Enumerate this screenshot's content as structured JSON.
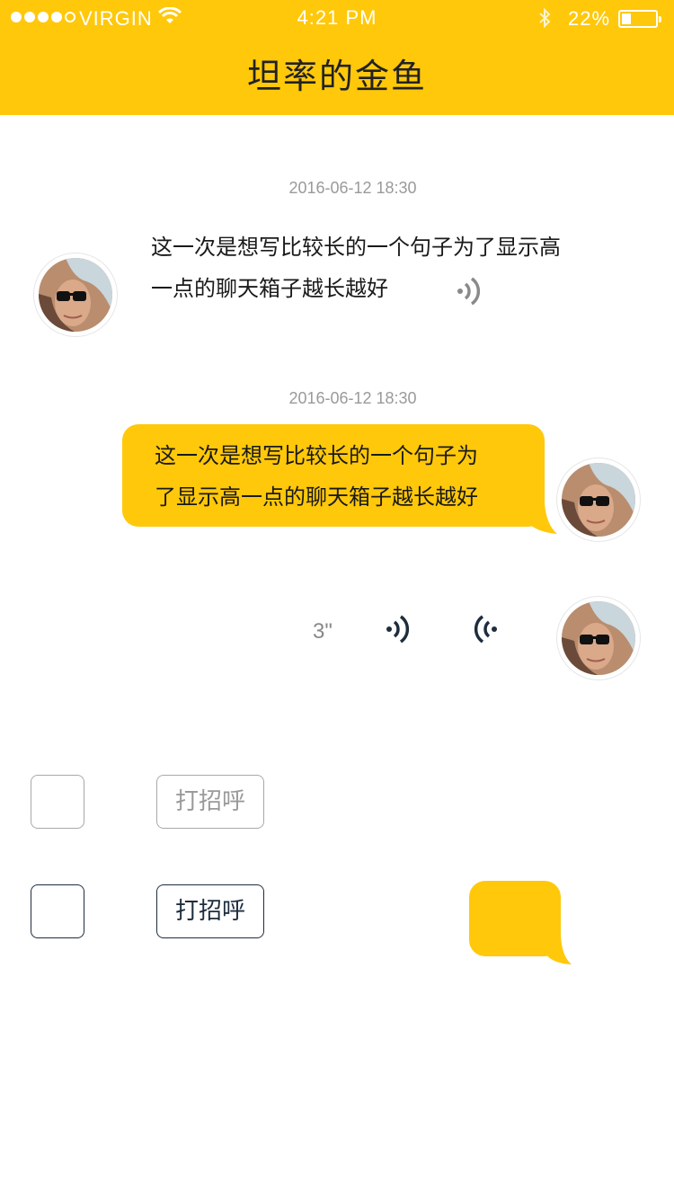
{
  "status_bar": {
    "carrier": "VIRGIN",
    "time": "4:21 PM",
    "battery_percent": "22%",
    "battery_level": 0.22,
    "signal_dots_filled": 4,
    "signal_dots_total": 5,
    "icons": [
      "wifi-icon",
      "bluetooth-icon",
      "battery-icon"
    ]
  },
  "nav": {
    "title": "坦率的金鱼"
  },
  "colors": {
    "accent": "#FFC80A",
    "dark": "#1E2D3D",
    "muted": "#9A9A9A"
  },
  "messages": [
    {
      "timestamp": "2016-06-12 18:30",
      "side": "left",
      "lines": [
        "这一次是想写比较长的一个句子为了显示高",
        "一点的聊天箱子越长越好"
      ],
      "icon": "voice-wave-icon"
    },
    {
      "timestamp": "2016-06-12 18:30",
      "side": "right",
      "lines": [
        "这一次是想写比较长的一个句子为",
        "了显示高一点的聊天箱子越长越好"
      ]
    },
    {
      "side": "right",
      "type": "voice",
      "duration": "3\"",
      "icons": [
        "voice-play-icon",
        "voice-record-icon"
      ]
    }
  ],
  "controls": [
    {
      "style": "inactive",
      "button_label": "打招呼"
    },
    {
      "style": "active",
      "button_label": "打招呼"
    }
  ]
}
